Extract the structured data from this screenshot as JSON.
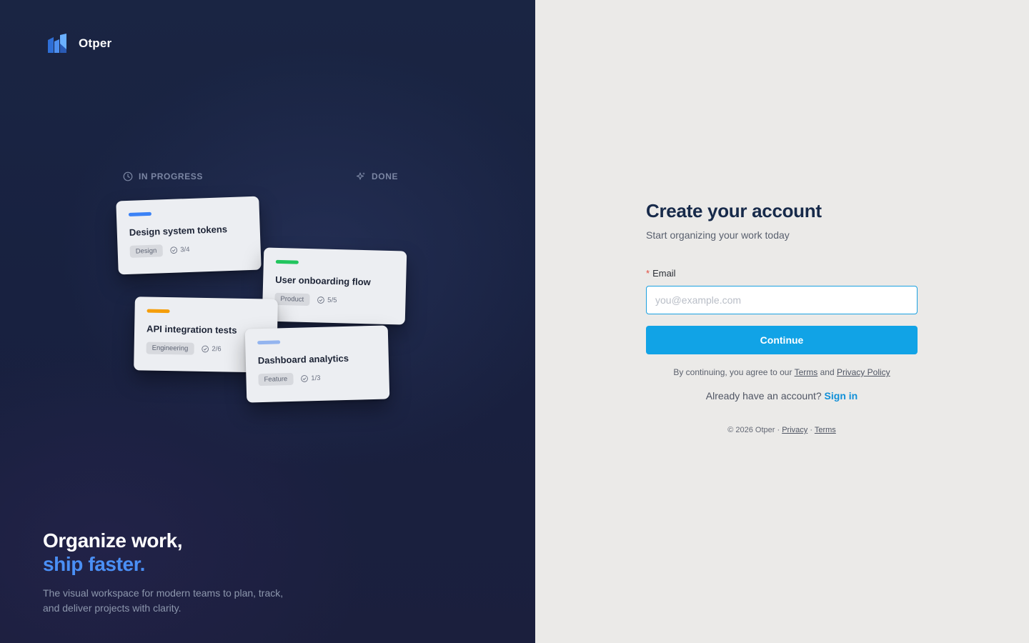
{
  "brand": {
    "name": "Otper",
    "icon": "otper-logo-icon"
  },
  "board": {
    "columns": [
      {
        "label": "IN PROGRESS",
        "icon": "clock-icon"
      },
      {
        "label": "DONE",
        "icon": "sparkles-icon"
      }
    ],
    "cards": [
      {
        "title": "Design system tokens",
        "tag": "Design",
        "progress": "3/4",
        "accent": "#3b82f6"
      },
      {
        "title": "User onboarding flow",
        "tag": "Product",
        "progress": "5/5",
        "accent": "#22c55e"
      },
      {
        "title": "API integration tests",
        "tag": "Engineering",
        "progress": "2/6",
        "accent": "#f59e0b"
      },
      {
        "title": "Dashboard analytics",
        "tag": "Feature",
        "progress": "1/3",
        "accent": "#93b4ef"
      }
    ]
  },
  "hero": {
    "line1": "Organize work,",
    "line2": "ship faster.",
    "description": "The visual workspace for modern teams to plan, track, and deliver projects with clarity."
  },
  "signup": {
    "title": "Create your account",
    "subtitle": "Start organizing your work today",
    "required_mark": "*",
    "email_label": "Email",
    "email_value": "",
    "email_placeholder": "you@example.com",
    "continue_label": "Continue",
    "legal_prefix": "By continuing, you agree to our",
    "terms_label": "Terms",
    "and": "and",
    "privacy_label": "Privacy Policy",
    "have_account": "Already have an account?",
    "signin_label": "Sign in"
  },
  "footer": {
    "copyright": "© 2026 Otper ·",
    "privacy": "Privacy",
    "separator": "·",
    "terms": "Terms"
  },
  "colors": {
    "left_bg": "#1a2543",
    "right_bg": "#ebeae8",
    "primary_button": "#11a3e6",
    "heading": "#172a4a",
    "hero_accent": "#4a8ff5",
    "link": "#1190d8"
  }
}
